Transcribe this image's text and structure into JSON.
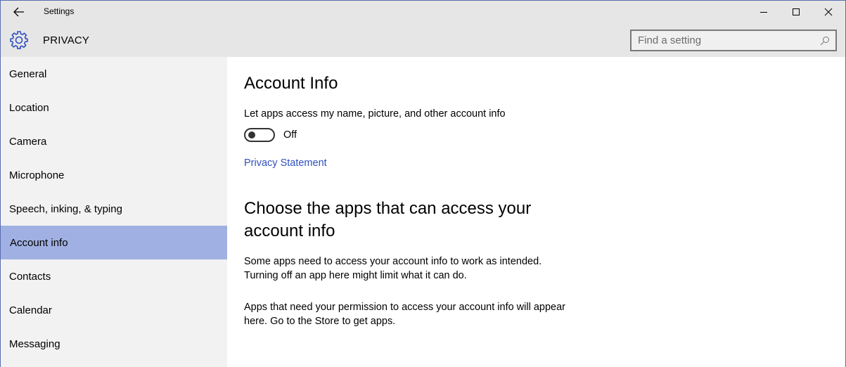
{
  "window": {
    "title": "Settings",
    "controls": {
      "minimize": "minimize",
      "maximize": "maximize",
      "close": "close"
    }
  },
  "header": {
    "section_title": "PRIVACY",
    "search": {
      "placeholder": "Find a setting",
      "value": ""
    }
  },
  "sidebar": {
    "items": [
      {
        "label": "General",
        "active": false
      },
      {
        "label": "Location",
        "active": false
      },
      {
        "label": "Camera",
        "active": false
      },
      {
        "label": "Microphone",
        "active": false
      },
      {
        "label": "Speech, inking, & typing",
        "active": false
      },
      {
        "label": "Account info",
        "active": true
      },
      {
        "label": "Contacts",
        "active": false
      },
      {
        "label": "Calendar",
        "active": false
      },
      {
        "label": "Messaging",
        "active": false
      }
    ]
  },
  "main": {
    "title": "Account Info",
    "toggle": {
      "label": "Let apps access my name, picture, and other account info",
      "state": "Off",
      "on": false
    },
    "privacy_link": "Privacy Statement",
    "section2_title": "Choose the apps that can access your account info",
    "paragraph1": "Some apps need to access your account info to work as intended. Turning off an app here might limit what it can do.",
    "paragraph2": "Apps that need your permission to access your account info will appear here. Go to the Store to get apps."
  },
  "colors": {
    "accent": "#2f4fbf",
    "selected_nav": "#a0b0e2",
    "chrome": "#e6e6e6",
    "sidebar": "#f2f2f2"
  }
}
